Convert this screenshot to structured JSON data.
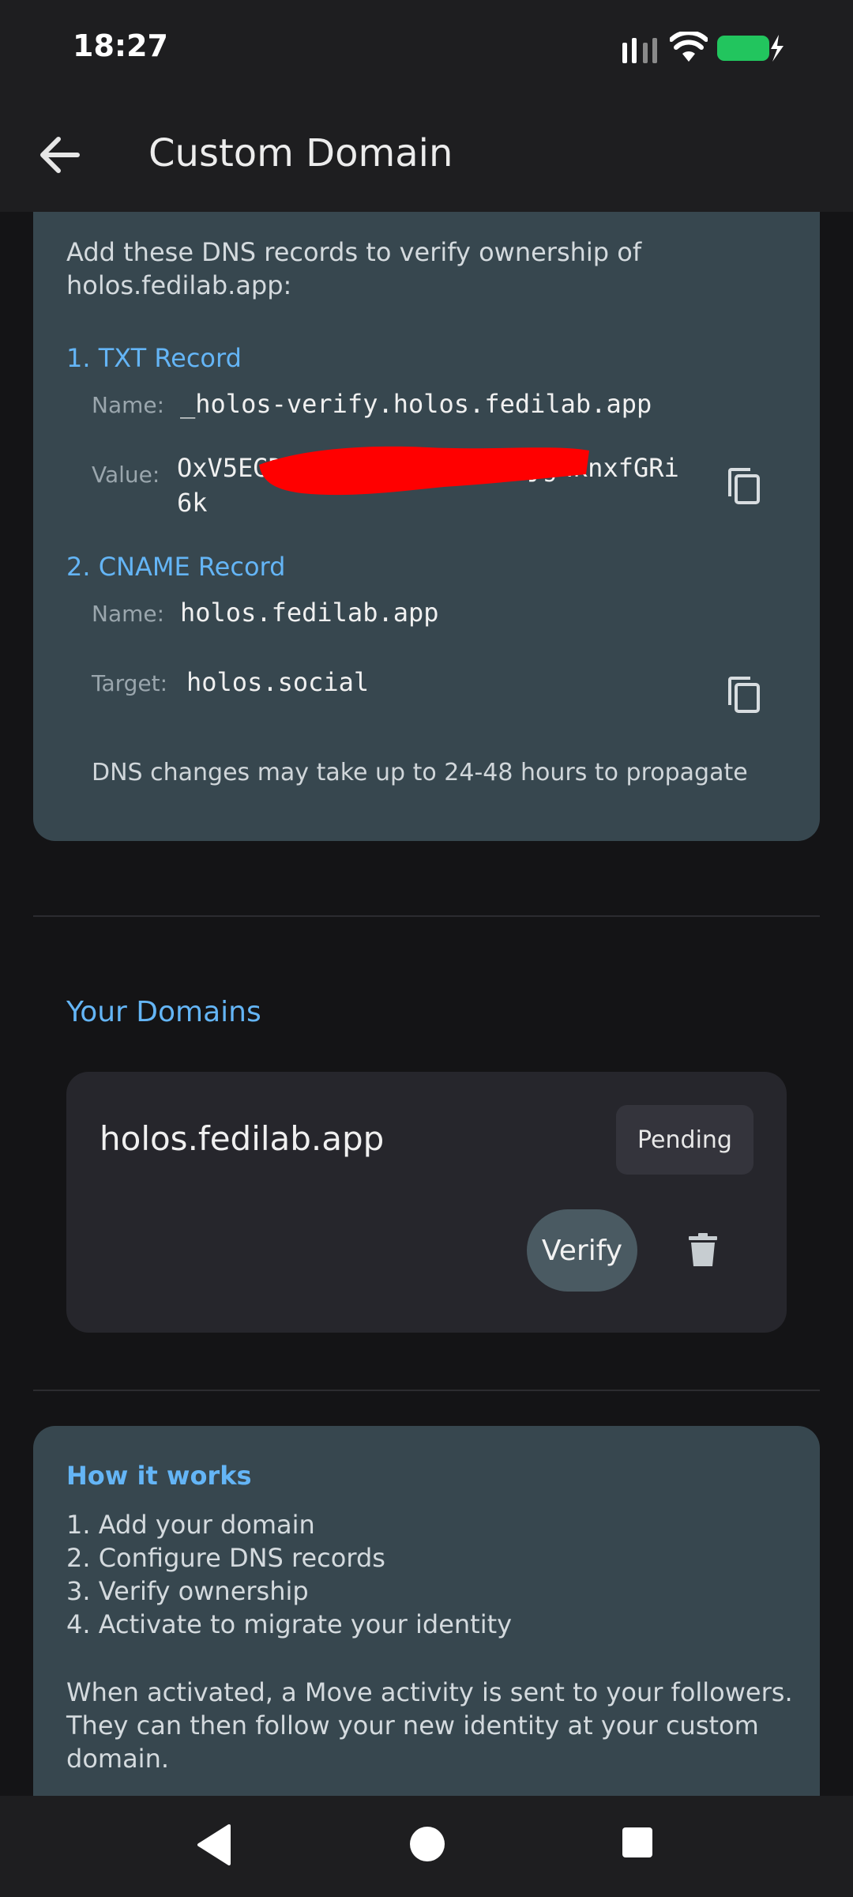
{
  "status_bar": {
    "time": "18:27",
    "battery_color": "#22c55e"
  },
  "app_bar": {
    "title": "Custom Domain",
    "back_icon": "arrow-left-icon"
  },
  "dns_card": {
    "intro": "Add these DNS records to verify ownership of holos.fedilab.app:",
    "txt_record": {
      "title": "1. TXT Record",
      "name_label": "Name:",
      "name_value": "_holos-verify.holos.fedilab.app",
      "value_label": "Value:",
      "value_visible": "OxV5EGDf1P K        c1rg7ARDV5jgHknxfGRi6k"
    },
    "cname_record": {
      "title": "2. CNAME Record",
      "name_label": "Name:",
      "name_value": "holos.fedilab.app",
      "target_label": "Target:",
      "target_value": "holos.social"
    },
    "note": "DNS changes may take up to 24-48 hours to propagate"
  },
  "your_domains": {
    "title": "Your Domains",
    "domains": [
      {
        "name": "holos.fedilab.app",
        "status": "Pending",
        "verify_label": "Verify"
      }
    ]
  },
  "how_it_works": {
    "title": "How it works",
    "steps": [
      "1. Add your domain",
      "2. Configure DNS records",
      "3. Verify ownership",
      "4. Activate to migrate your identity"
    ],
    "description": "When activated, a Move activity is sent to your followers. They can then follow your new identity at your custom domain."
  },
  "colors": {
    "accent": "#64b5f6",
    "card": "#37474f",
    "background": "#141416"
  }
}
